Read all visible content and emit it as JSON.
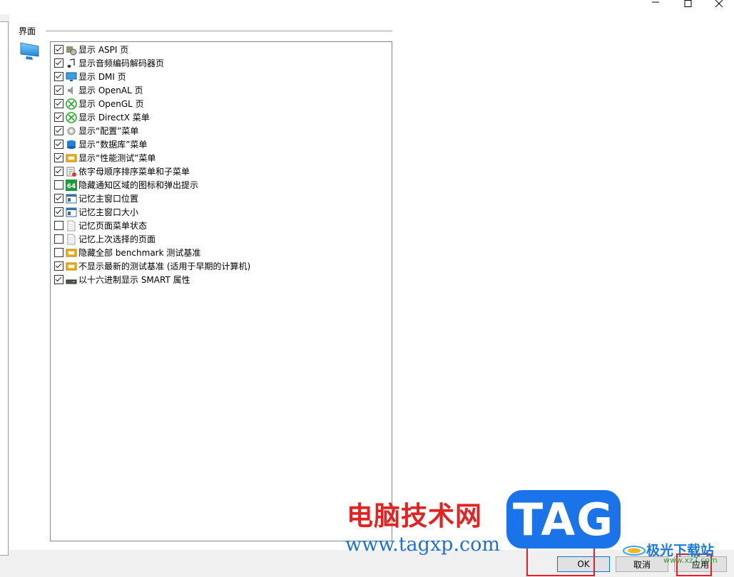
{
  "window": {
    "buttons": [
      {
        "name": "minimize",
        "icon": "minimize-icon"
      },
      {
        "name": "maximize",
        "icon": "maximize-icon"
      },
      {
        "name": "close",
        "icon": "close-icon"
      }
    ]
  },
  "group": {
    "title": "界面"
  },
  "options": [
    {
      "label": "显示 ASPI 页",
      "checked": true,
      "icon": "aspi-icon"
    },
    {
      "label": "显示音频编码解码器页",
      "checked": true,
      "icon": "music-note-icon"
    },
    {
      "label": "显示 DMI 页",
      "checked": true,
      "icon": "monitor-icon"
    },
    {
      "label": "显示 OpenAL 页",
      "checked": true,
      "icon": "speaker-icon"
    },
    {
      "label": "显示 OpenGL 页",
      "checked": true,
      "icon": "xbox-icon"
    },
    {
      "label": "显示 DirectX 菜单",
      "checked": true,
      "icon": "xbox-icon"
    },
    {
      "label": "显示“配置”菜单",
      "checked": true,
      "icon": "gear-icon"
    },
    {
      "label": "显示“数据库”菜单",
      "checked": true,
      "icon": "database-icon"
    },
    {
      "label": "显示“性能测试”菜单",
      "checked": true,
      "icon": "benchmark-icon"
    },
    {
      "label": "依字母顺序排序菜单和子菜单",
      "checked": true,
      "icon": "sort-icon"
    },
    {
      "label": "隐藏通知区域的图标和弹出提示",
      "checked": false,
      "icon": "badge-64-icon"
    },
    {
      "label": "记忆主窗口位置",
      "checked": true,
      "icon": "window-icon"
    },
    {
      "label": "记忆主窗口大小",
      "checked": true,
      "icon": "window-icon"
    },
    {
      "label": "记忆页面菜单状态",
      "checked": false,
      "icon": "page-icon"
    },
    {
      "label": "记忆上次选择的页面",
      "checked": false,
      "icon": "page-icon"
    },
    {
      "label": "隐藏全部 benchmark 测试基准",
      "checked": false,
      "icon": "benchmark-icon"
    },
    {
      "label": "不显示最新的测试基准 (适用于早期的计算机)",
      "checked": true,
      "icon": "benchmark-icon"
    },
    {
      "label": "以十六进制显示 SMART 属性",
      "checked": true,
      "icon": "drive-icon"
    }
  ],
  "footer": {
    "ok_label": "OK",
    "cancel_label": "取消",
    "apply_label": "应用"
  },
  "watermark": {
    "cn_text": "电脑技术网",
    "url_text": "www.tagxp.com",
    "tag_text": "TAG",
    "site_text": "极光下载站",
    "site_url": "www.xz7.com"
  },
  "colors": {
    "accent": "#0078d7",
    "highlight_red": "#e0202a",
    "watermark_blue": "#1a73e8",
    "watermark_red": "#e02323"
  }
}
